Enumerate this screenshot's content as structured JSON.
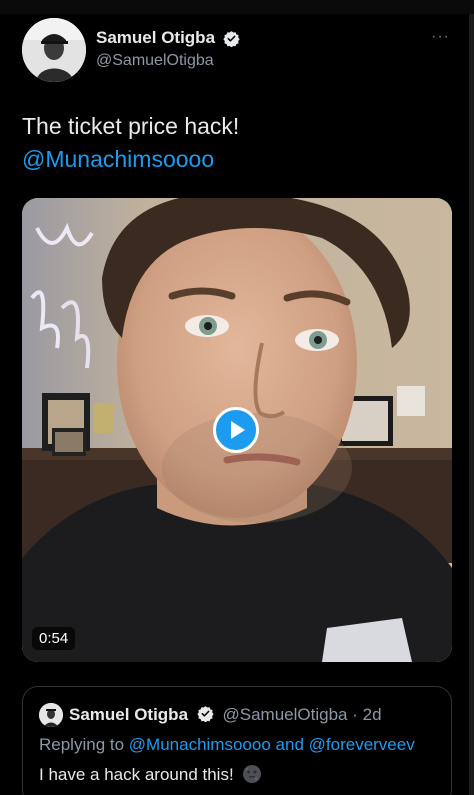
{
  "tweet": {
    "author_name": "Samuel Otigba",
    "handle": "@SamuelOtigba",
    "text_line1": "The ticket price hack!",
    "mention": "@Munachimsoooo",
    "more_label": "···"
  },
  "video": {
    "duration": "0:54",
    "play_icon": "play-icon"
  },
  "quote": {
    "author_name": "Samuel Otigba",
    "handle": "@SamuelOtigba",
    "separator": "·",
    "time": "2d",
    "replying_prefix": "Replying to",
    "reply_mention1": "@Munachimsoooo",
    "reply_and": "and",
    "reply_mention2": "@foreverveev",
    "text": "I have a hack around this!"
  },
  "colors": {
    "background": "#000000",
    "text": "#e7e9ea",
    "secondary": "#8b98a5",
    "accent": "#1d9bf0"
  }
}
